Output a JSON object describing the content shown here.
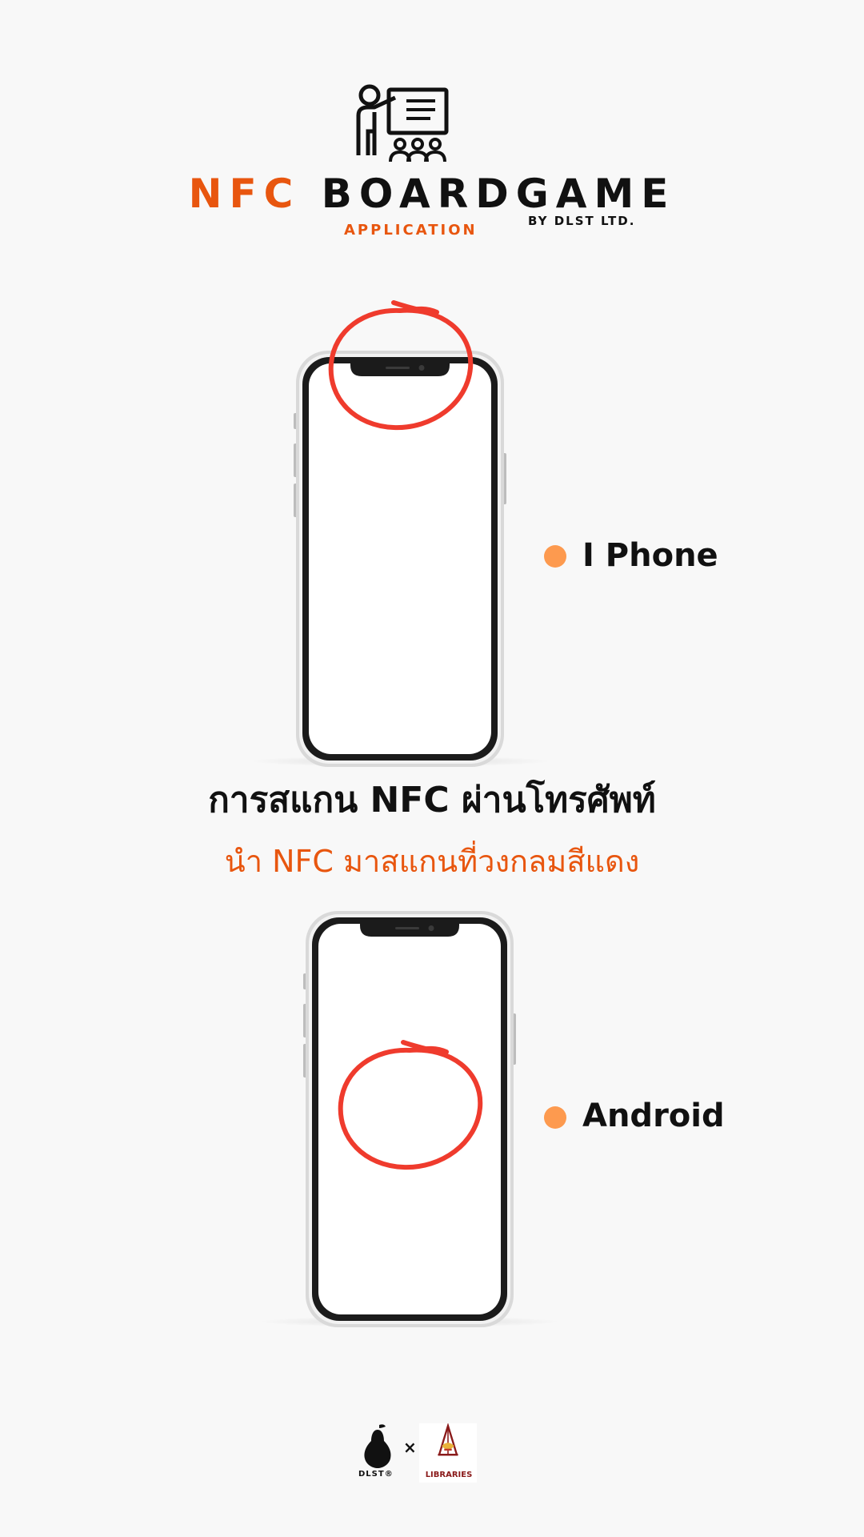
{
  "header": {
    "title_nfc": "NFC",
    "title_boardgame": "BOARDGAME",
    "subtitle_application": "APPLICATION",
    "subtitle_by": "BY DLST LTD."
  },
  "devices": {
    "iphone_label": "I Phone",
    "android_label": "Android"
  },
  "instructions": {
    "title": "การสแกน NFC ผ่านโทรศัพท์",
    "subtitle": "นำ NFC มาสแกนที่วงกลมสีแดง"
  },
  "footer": {
    "dlst_label": "DLST®",
    "separator": "×",
    "partner_label": "LIBRARIES"
  },
  "colors": {
    "accent_orange": "#e8560f",
    "bullet_orange": "#fd9a4f",
    "circle_red": "#ef3b2d",
    "text_dark": "#111111",
    "background": "#f8f8f8"
  },
  "icons": [
    "teacher-presentation-icon",
    "pear-icon",
    "university-emblem-icon"
  ]
}
